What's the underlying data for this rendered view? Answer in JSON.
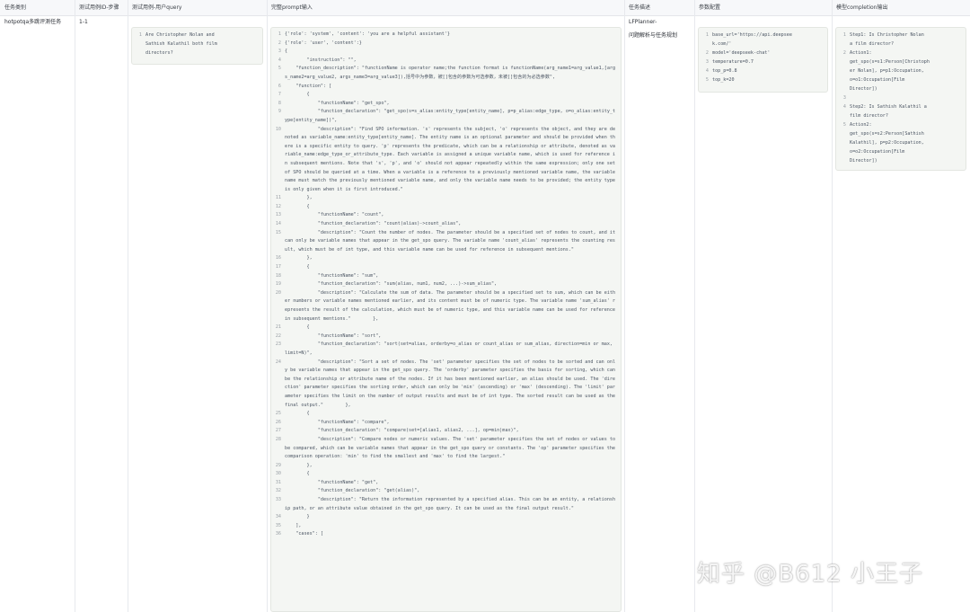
{
  "headers": [
    "任务类别",
    "测试用例ID-步骤",
    "测试用例-用户query",
    "完整prompt输入",
    "任务描述",
    "参数配置",
    "模型completion输出"
  ],
  "row": {
    "category": "hotpotqa多跳评测任务",
    "case_id": "1-1",
    "query_lines": [
      {
        "n": "1",
        "t": "Are Christopher Nolan and"
      },
      {
        "n": "",
        "t": "Sathish Kalathil both film"
      },
      {
        "n": "",
        "t": "directors?"
      }
    ],
    "task_desc": [
      "LFPlanner-",
      "问题解析与任务规划"
    ],
    "params": [
      {
        "n": "1",
        "t": "base_url='https://api.deepsee"
      },
      {
        "n": "",
        "t": "k.com/'"
      },
      {
        "n": "2",
        "t": "model='deepseek-chat'"
      },
      {
        "n": "3",
        "t": "temperature=0.7"
      },
      {
        "n": "4",
        "t": "top_p=0.8"
      },
      {
        "n": "5",
        "t": "top_k=20"
      }
    ],
    "completion": [
      {
        "n": "1",
        "t": "Step1: Is Christopher Nolan"
      },
      {
        "n": "",
        "t": "a film director?"
      },
      {
        "n": "2",
        "t": "Action1:"
      },
      {
        "n": "",
        "t": "get_spo(s=s1:Person[Christoph"
      },
      {
        "n": "",
        "t": "er Nolan], p=p1:Occupation,"
      },
      {
        "n": "",
        "t": "o=o1:Occupation[Film"
      },
      {
        "n": "",
        "t": "Director])"
      },
      {
        "n": "3",
        "t": ""
      },
      {
        "n": "4",
        "t": "Step2: Is Sathish Kalathil a"
      },
      {
        "n": "",
        "t": "film director?"
      },
      {
        "n": "5",
        "t": "Action2:"
      },
      {
        "n": "",
        "t": "get_spo(s=s2:Person[Sathish"
      },
      {
        "n": "",
        "t": "Kalathil], p=p2:Occupation,"
      },
      {
        "n": "",
        "t": "o=o2:Occupation[Film"
      },
      {
        "n": "",
        "t": "Director])"
      }
    ],
    "prompt": [
      {
        "n": "1",
        "t": "{'role': 'system', 'content': 'you are a helpful assistant'}"
      },
      {
        "n": "2",
        "t": "{'role': 'user', 'content':}"
      },
      {
        "n": "3",
        "t": "{"
      },
      {
        "n": "4",
        "t": "        \"instruction\": \"\","
      },
      {
        "n": "5",
        "t": "    \"function_description\": \"functionName is operator name;the function format is functionName(arg_name1=arg_value1,[args_name2=arg_value2, args_name3=arg_value3]),括号中为参数，被[]包含的参数为可选参数，未被[]包含的为必选参数\","
      },
      {
        "n": "6",
        "t": "    \"function\": ["
      },
      {
        "n": "7",
        "t": "        {"
      },
      {
        "n": "8",
        "t": "            \"functionName\": \"get_spo\","
      },
      {
        "n": "9",
        "t": "            \"function_declaration\": \"get_spo(s=s_alias:entity_type[entity_name], p=p_alias:edge_type, o=o_alias:entity_type[entity_name])\","
      },
      {
        "n": "10",
        "t": "            \"description\": \"Find SPO information. 's' represents the subject, 'o' represents the object, and they are denoted as variable_name:entity_type[entity_name]. The entity name is an optional parameter and should be provided when there is a specific entity to query. 'p' represents the predicate, which can be a relationship or attribute, denoted as variable_name:edge_type_or_attribute_type. Each variable is assigned a unique variable name, which is used for reference in subsequent mentions. Note that 's', 'p', and 'o' should not appear repeatedly within the same expression; only one set of SPO should be queried at a time. When a variable is a reference to a previously mentioned variable name, the variable name must match the previously mentioned variable name, and only the variable name needs to be provided; the entity type is only given when it is first introduced.\""
      },
      {
        "n": "11",
        "t": "        },"
      },
      {
        "n": "12",
        "t": "        {"
      },
      {
        "n": "13",
        "t": "            \"functionName\": \"count\","
      },
      {
        "n": "14",
        "t": "            \"function_declaration\": \"count(alias)->count_alias\","
      },
      {
        "n": "15",
        "t": "            \"description\": \"Count the number of nodes. The parameter should be a specified set of nodes to count, and it can only be variable names that appear in the get_spo query. The variable name 'count_alias' represents the counting result, which must be of int type, and this variable name can be used for reference in subsequent mentions.\""
      },
      {
        "n": "16",
        "t": "        },"
      },
      {
        "n": "17",
        "t": "        {"
      },
      {
        "n": "18",
        "t": "            \"functionName\": \"sum\","
      },
      {
        "n": "19",
        "t": "            \"function_declaration\": \"sum(alias, num1, num2, ...)->sum_alias\","
      },
      {
        "n": "20",
        "t": "            \"description\": \"Calculate the sum of data. The parameter should be a specified set to sum, which can be either numbers or variable names mentioned earlier, and its content must be of numeric type. The variable name 'sum_alias' represents the result of the calculation, which must be of numeric type, and this variable name can be used for reference in subsequent mentions.\"        },"
      },
      {
        "n": "21",
        "t": "        {"
      },
      {
        "n": "22",
        "t": "            \"functionName\": \"sort\","
      },
      {
        "n": "23",
        "t": "            \"function_declaration\": \"sort(set=alias, orderby=o_alias or count_alias or sum_alias, direction=min or max, limit=N)\","
      },
      {
        "n": "24",
        "t": "            \"description\": \"Sort a set of nodes. The 'set' parameter specifies the set of nodes to be sorted and can only be variable names that appear in the get_spo query. The 'orderby' parameter specifies the basis for sorting, which can be the relationship or attribute name of the nodes. If it has been mentioned earlier, an alias should be used. The 'direction' parameter specifies the sorting order, which can only be 'min' (ascending) or 'max' (descending). The 'limit' parameter specifies the limit on the number of output results and must be of int type. The sorted result can be used as the final output.\"        },"
      },
      {
        "n": "25",
        "t": "        {"
      },
      {
        "n": "26",
        "t": "            \"functionName\": \"compare\","
      },
      {
        "n": "27",
        "t": "            \"function_declaration\": \"compare(set=[alias1, alias2, ...], op=min|max)\","
      },
      {
        "n": "28",
        "t": "            \"description\": \"Compare nodes or numeric values. The 'set' parameter specifies the set of nodes or values to be compared, which can be variable names that appear in the get_spo query or constants. The 'op' parameter specifies the comparison operation: 'min' to find the smallest and 'max' to find the largest.\""
      },
      {
        "n": "29",
        "t": "        },"
      },
      {
        "n": "30",
        "t": "        {"
      },
      {
        "n": "31",
        "t": "            \"functionName\": \"get\","
      },
      {
        "n": "32",
        "t": "            \"function_declaration\": \"get(alias)\","
      },
      {
        "n": "33",
        "t": "            \"description\": \"Return the information represented by a specified alias. This can be an entity, a relationship path, or an attribute value obtained in the get_spo query. It can be used as the final output result.\""
      },
      {
        "n": "34",
        "t": "        }"
      },
      {
        "n": "35",
        "t": "    ],"
      },
      {
        "n": "36",
        "t": "    \"cases\": ["
      }
    ]
  },
  "watermark": "知乎 @B612 小王子"
}
